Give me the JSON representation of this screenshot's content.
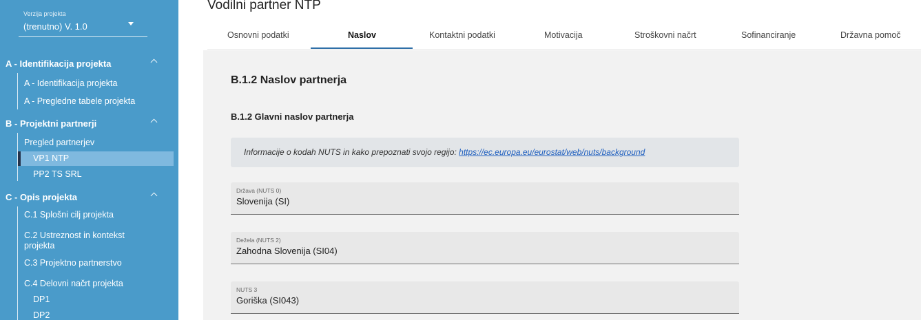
{
  "sidebar": {
    "version_label": "Verzija projekta",
    "version_value": "(trenutno) V. 1.0",
    "sections": [
      {
        "label": "A - Identifikacija projekta"
      },
      {
        "label": "B - Projektni partnerji"
      },
      {
        "label": "C - Opis projekta"
      }
    ],
    "items": [
      {
        "label": "A - Identifikacija projekta"
      },
      {
        "label": "A - Pregledne tabele projekta"
      },
      {
        "label": "Pregled partnerjev"
      },
      {
        "label": "VP1 NTP"
      },
      {
        "label": "PP2 TS SRL"
      },
      {
        "label": "C.1 Splošni cilj projekta"
      },
      {
        "label": "C.2 Ustreznost in kontekst projekta"
      },
      {
        "label": "C.3 Projektno partnerstvo"
      },
      {
        "label": "C.4 Delovni načrt projekta"
      },
      {
        "label": "DP1"
      },
      {
        "label": "DP2"
      }
    ]
  },
  "main": {
    "title": "Vodilni partner NTP",
    "tabs": [
      {
        "label": "Osnovni podatki"
      },
      {
        "label": "Naslov"
      },
      {
        "label": "Kontaktni podatki"
      },
      {
        "label": "Motivacija"
      },
      {
        "label": "Stroškovni načrt"
      },
      {
        "label": "Sofinanciranje"
      },
      {
        "label": "Državna pomoč"
      }
    ],
    "active_tab": "Naslov",
    "heading": "B.1.2 Naslov partnerja",
    "subheading": "B.1.2 Glavni naslov partnerja",
    "info_text": "Informacije o kodah NUTS in kako prepoznati svojo regijo: ",
    "info_link": "https://ec.europa.eu/eurostat/web/nuts/background",
    "fields": [
      {
        "label": "Država (NUTS 0)",
        "value": "Slovenija (SI)"
      },
      {
        "label": "Dežela (NUTS 2)",
        "value": "Zahodna Slovenija (SI04)"
      },
      {
        "label": "NUTS 3",
        "value": "Goriška (SI043)"
      }
    ]
  },
  "colors": {
    "sidebar_bg": "#4a9bca",
    "active_item_bg": "#7fb9df",
    "active_marker": "#24324a",
    "tab_underline": "#2f6fa8",
    "link": "#1f5fbf"
  }
}
